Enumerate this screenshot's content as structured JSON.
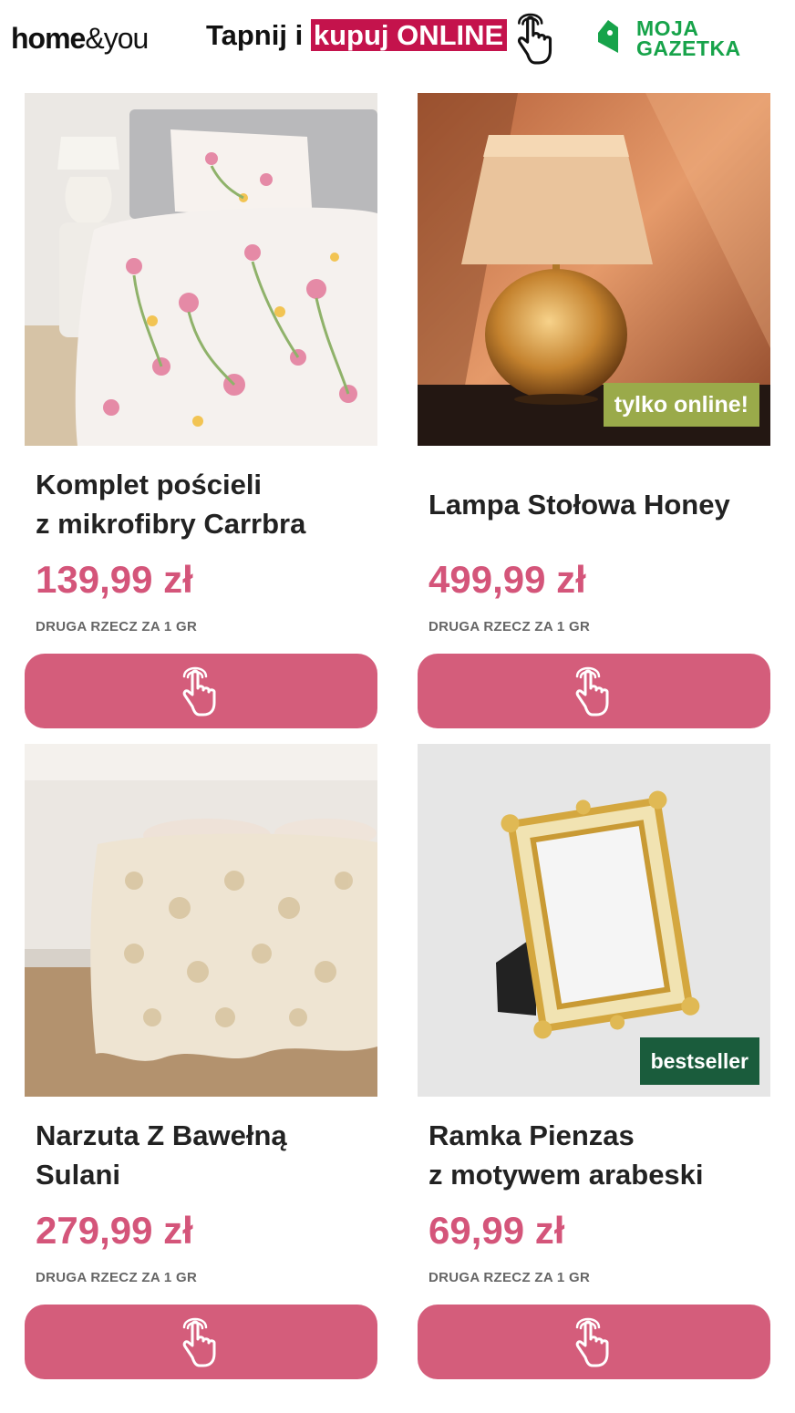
{
  "header": {
    "brand_home": "home",
    "brand_amp": "&",
    "brand_you": "you",
    "tap_text": "Tapnij i",
    "tap_highlight": "kupuj ONLINE",
    "tap_icon": "hand-pointer-icon",
    "partner_line1": "MOJA",
    "partner_line2": "GAZETKA",
    "partner_color": "#17a34a"
  },
  "colors": {
    "price": "#d4557a",
    "button": "#d45d7b",
    "highlight": "#c4134c",
    "badge_online": "#9aaa4a",
    "badge_bestseller": "#1a5c3c"
  },
  "products": [
    {
      "title_line1": "Komplet pościeli",
      "title_line2": "z mikrofibry Carrbra",
      "price": "139,99 zł",
      "promo": "DRUGA RZECZ ZA 1 GR",
      "badge": "",
      "button_icon": "hand-pointer-icon"
    },
    {
      "title_line1": "Lampa Stołowa Honey",
      "title_line2": "",
      "price": "499,99 zł",
      "promo": "DRUGA RZECZ ZA 1 GR",
      "badge": "tylko online!",
      "button_icon": "hand-pointer-icon"
    },
    {
      "title_line1": "Narzuta Z Bawełną",
      "title_line2": "Sulani",
      "price": "279,99 zł",
      "promo": "DRUGA RZECZ ZA 1 GR",
      "badge": "",
      "button_icon": "hand-pointer-icon"
    },
    {
      "title_line1": "Ramka Pienzas",
      "title_line2": "z motywem arabeski",
      "price": "69,99 zł",
      "promo": "DRUGA RZECZ ZA 1 GR",
      "badge": "bestseller",
      "button_icon": "hand-pointer-icon"
    }
  ]
}
